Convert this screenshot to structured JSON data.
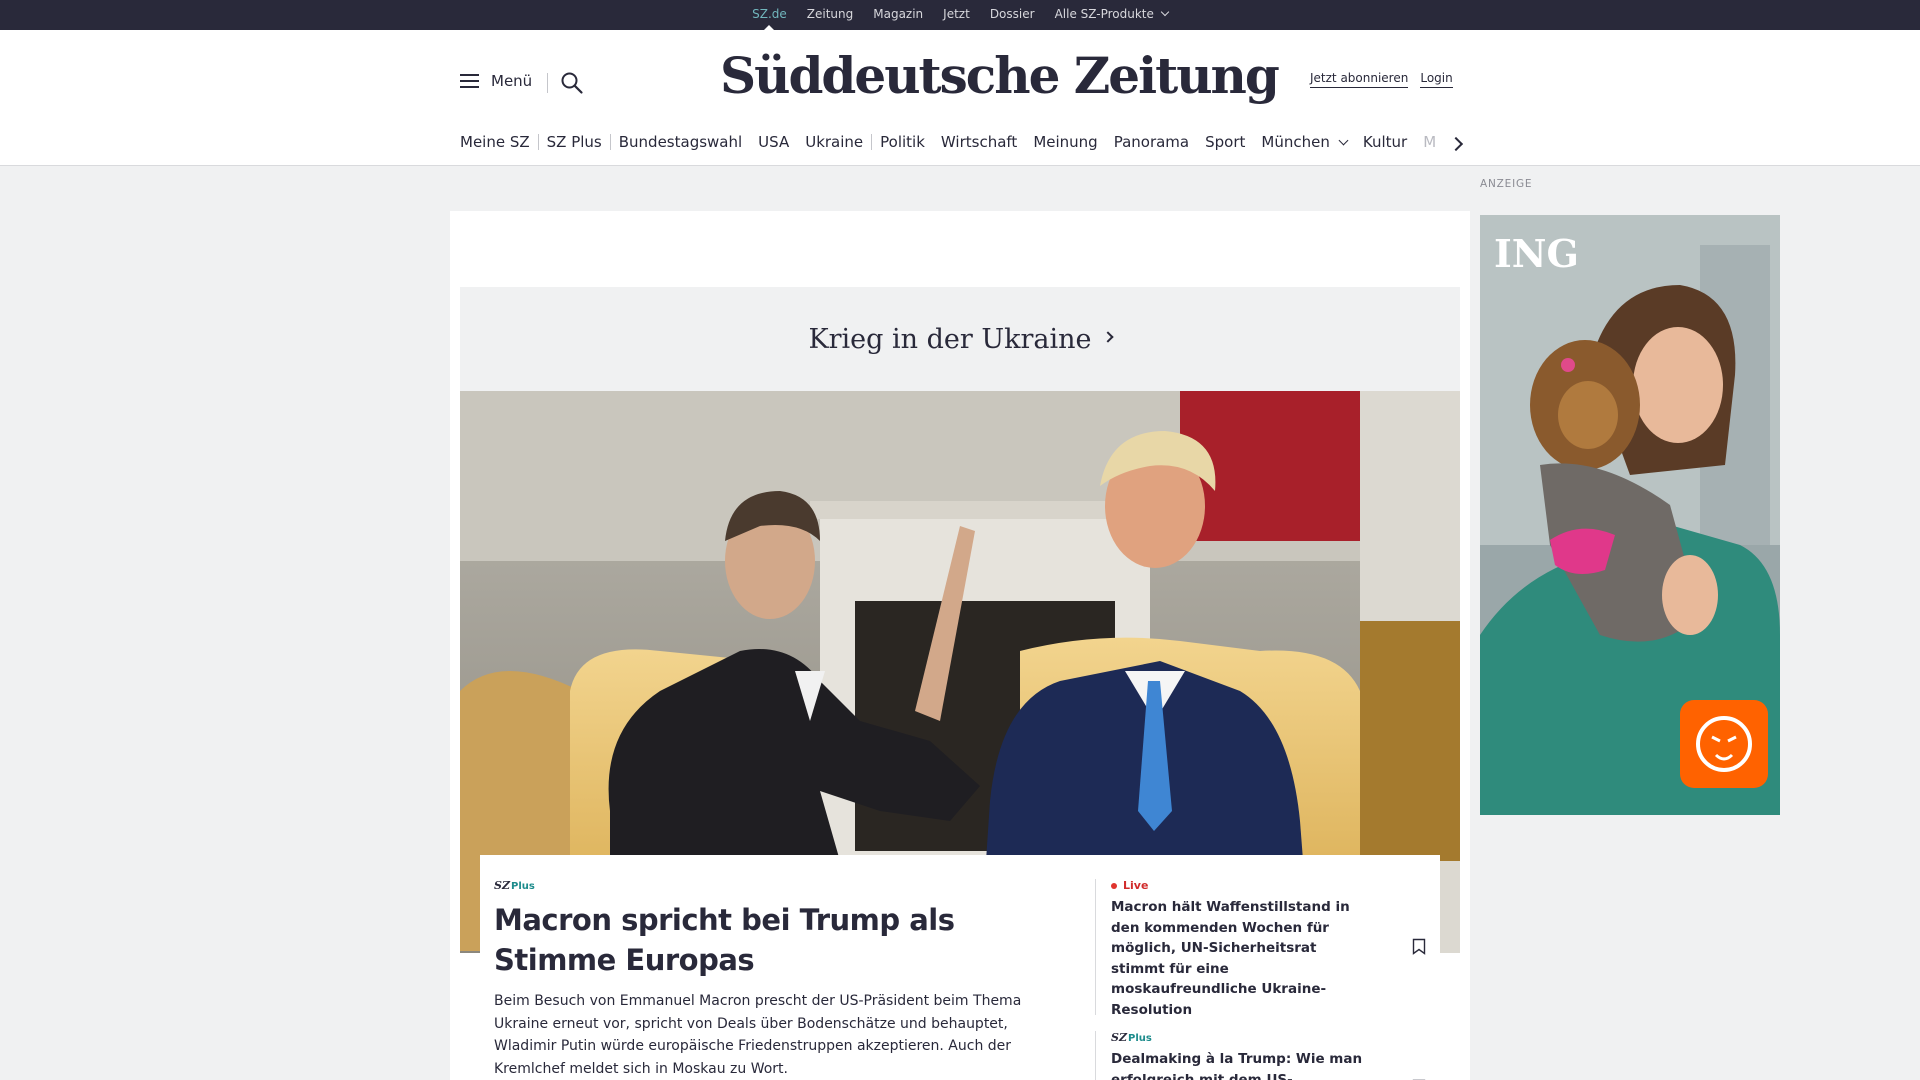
{
  "topbar": {
    "links": [
      "SZ.de",
      "Zeitung",
      "Magazin",
      "Jetzt",
      "Dossier",
      "Alle SZ-Produkte"
    ]
  },
  "header": {
    "menu_label": "Menü",
    "logo_text": "Süddeutsche Zeitung",
    "subscribe_label": "Jetzt abonnieren",
    "login_label": "Login"
  },
  "nav": {
    "items": [
      "Meine SZ",
      "SZ Plus",
      "Bundestagswahl",
      "USA",
      "Ukraine",
      "Politik",
      "Wirtschaft",
      "Meinung",
      "Panorama",
      "Sport",
      "München",
      "Kultur",
      "M"
    ]
  },
  "main": {
    "topic_title": "Krieg in der Ukraine",
    "lead": {
      "badge_sz": "SZ",
      "badge_plus": "Plus",
      "title": "Macron spricht bei Trump als Stimme Europas",
      "description": "Beim Besuch von Emmanuel Macron prescht der US-Präsident beim Thema Ukraine erneut vor, spricht von Deals über Bodenschätze und behauptet, Wladimir Putin würde europäische Friedenstruppen akzeptieren. Auch der Kremlchef meldet sich in Moskau zu Wort."
    },
    "side_stories": [
      {
        "badge": "Live",
        "title": "Macron hält Waffenstillstand in den kommenden Wochen für möglich, UN-Sicherheitsrat stimmt für eine moskaufreundliche Ukraine-Resolution"
      },
      {
        "badge_sz": "SZ",
        "badge_plus": "Plus",
        "title": "Dealmaking à la Trump: Wie man erfolgreich mit dem US-Präsidenten verhandelt"
      }
    ]
  },
  "ad": {
    "label": "ANZEIGE",
    "brand": "ING"
  },
  "colors": {
    "topbar_bg": "#29293a",
    "accent_teal": "#71b6bd",
    "live_red": "#d12c2c",
    "ing_orange": "#ff6200",
    "text": "#29293a",
    "page_bg": "#f0f1f2"
  }
}
